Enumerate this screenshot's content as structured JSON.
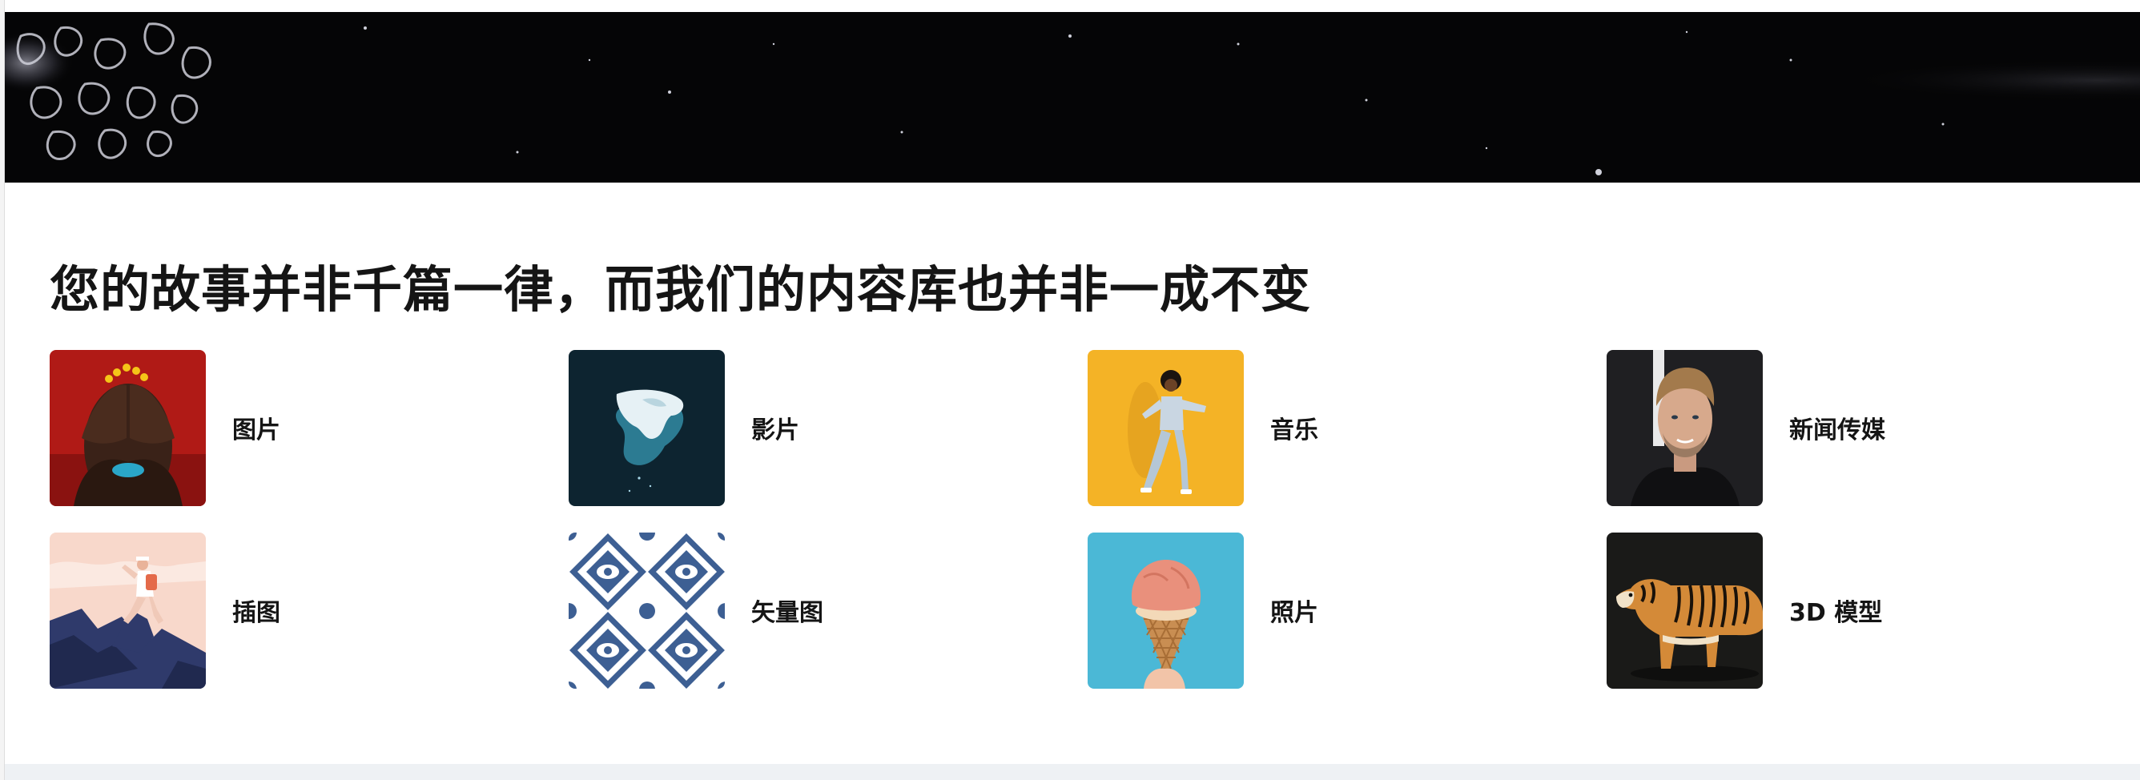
{
  "hero": {
    "background": "#050506"
  },
  "section": {
    "heading": "您的故事并非千篇一律，而我们的内容库也并非一成不变"
  },
  "categories": [
    {
      "label": "图片",
      "icon": "woman-covering-eyes-image"
    },
    {
      "label": "影片",
      "icon": "iceberg-aerial-image"
    },
    {
      "label": "音乐",
      "icon": "dancing-person-image"
    },
    {
      "label": "新闻传媒",
      "icon": "man-portrait-image"
    },
    {
      "label": "插图",
      "icon": "hiker-illustration-image"
    },
    {
      "label": "矢量图",
      "icon": "pattern-tile-image"
    },
    {
      "label": "照片",
      "icon": "ice-cream-cone-image"
    },
    {
      "label": "3D 模型",
      "icon": "tiger-3d-image"
    }
  ],
  "colors": {
    "heading": "#151515",
    "footer_band": "#eef1f4"
  }
}
